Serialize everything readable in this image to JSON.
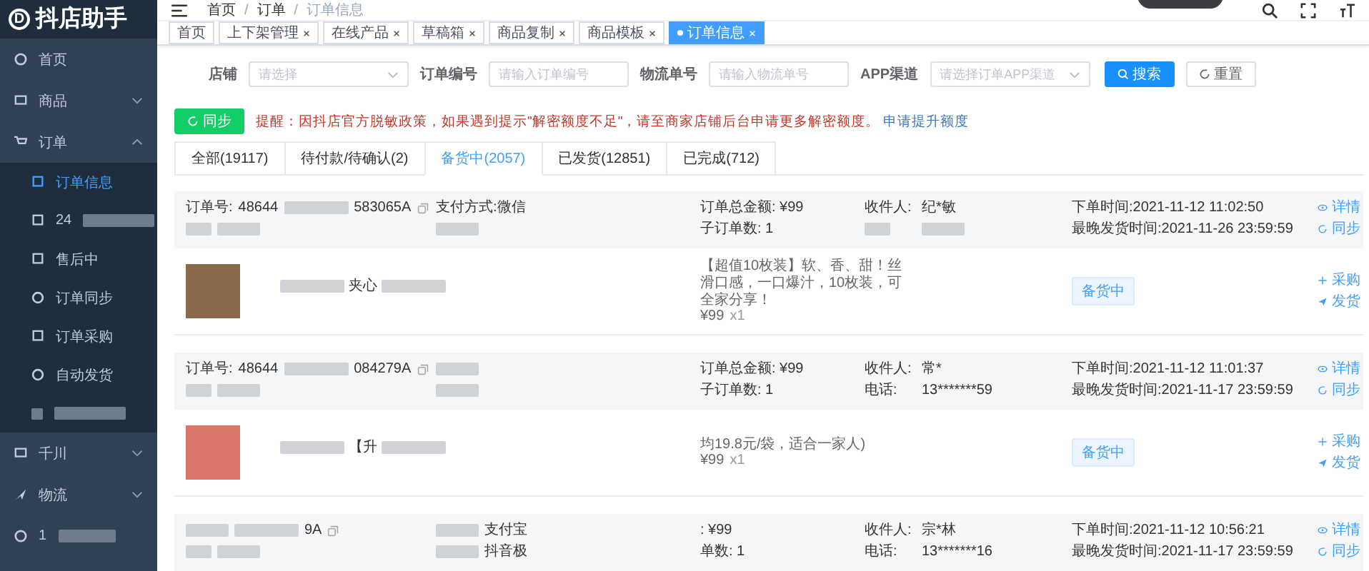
{
  "app": {
    "logo_letter": "D",
    "title": "抖店助手"
  },
  "sidebar": {
    "items": [
      {
        "label": "首页",
        "selected": false,
        "has_children": false,
        "blurred": false
      },
      {
        "label": "商品",
        "expanded": false,
        "selected": false,
        "has_children": true,
        "blurred": false
      },
      {
        "label": "订单",
        "expanded": true,
        "selected": false,
        "has_children": true,
        "blurred": false,
        "children": [
          {
            "label": "订单信息",
            "selected": true,
            "blurred": false
          },
          {
            "label": "24",
            "selected": false,
            "blurred": true
          },
          {
            "label": "售后中",
            "selected": false,
            "blurred": false
          },
          {
            "label": "订单同步",
            "selected": false,
            "blurred": false
          },
          {
            "label": "订单采购",
            "selected": false,
            "blurred": false
          },
          {
            "label": "自动发货",
            "selected": false,
            "blurred": false
          },
          {
            "selected": false,
            "blurred": true
          }
        ]
      },
      {
        "label": "千川",
        "expanded": false,
        "selected": false,
        "has_children": true,
        "blurred": false
      },
      {
        "label": "物流",
        "expanded": false,
        "selected": false,
        "has_children": true,
        "blurred": false
      },
      {
        "label": "1",
        "selected": false,
        "has_children": false,
        "blurred": true
      }
    ]
  },
  "breadcrumb": [
    "首页",
    "订单",
    "订单信息"
  ],
  "breadcrumb_separator": "/",
  "tags": [
    {
      "label": "首页",
      "closable": false,
      "selected": false
    },
    {
      "label": "上下架管理",
      "closable": true,
      "selected": false
    },
    {
      "label": "在线产品",
      "closable": true,
      "selected": false
    },
    {
      "label": "草稿箱",
      "closable": true,
      "selected": false
    },
    {
      "label": "商品复制",
      "closable": true,
      "selected": false
    },
    {
      "label": "商品模板",
      "closable": true,
      "selected": false
    },
    {
      "label": "订单信息",
      "closable": true,
      "selected": true
    }
  ],
  "filters": [
    {
      "label": "店铺",
      "kind": "select",
      "placeholder": "请选择"
    },
    {
      "label": "订单编号",
      "kind": "input",
      "placeholder": "请输入订单编号"
    },
    {
      "label": "物流单号",
      "kind": "input",
      "placeholder": "请输入物流单号"
    },
    {
      "label": "APP渠道",
      "kind": "select",
      "placeholder": "请选择订单APP渠道"
    }
  ],
  "search_button": "搜索",
  "reset_button": "重置",
  "sync_button": "同步",
  "notice": "提醒：因抖店官方脱敏政策，如果遇到提示\"解密额度不足\"，请至商家店铺后台申请更多解密额度。",
  "notice_link": "申请提升额度",
  "tabs": [
    {
      "label": "全部(19117)",
      "selected": false
    },
    {
      "label": "待付款/待确认(2)",
      "selected": false
    },
    {
      "label": "备货中(2057)",
      "selected": true
    },
    {
      "label": "已发货(12851)",
      "selected": false
    },
    {
      "label": "已完成(712)",
      "selected": false
    }
  ],
  "orders": [
    {
      "order_label": "订单号:",
      "order_no_start": "48644",
      "order_no_end": "583065A",
      "pay": [
        "支付方式:微信"
      ],
      "amount": "订单总金额: ¥99",
      "sub_count": "子订单数: 1",
      "recipient_label": "收件人:",
      "recipient": "纪*敏",
      "order_time": "下单时间:2021-11-12 11:02:50",
      "ship_time": "最晚发货时间:2021-11-26 23:59:59",
      "detail": "详情",
      "sync": "同步",
      "item": {
        "title": "夹心",
        "desc": "【超值10枚装】软、香、甜！丝滑口感，一口爆汁，10枚装，可全家分享！",
        "price": "¥99",
        "qty": "x1",
        "status": "备货中",
        "buy": "采购",
        "ship": "发货"
      }
    },
    {
      "order_label": "订单号:",
      "order_no_start": "48644",
      "order_no_end": "084279A",
      "amount": "订单总金额: ¥99",
      "sub_count": "子订单数: 1",
      "recipient_label": "收件人:",
      "recipient": "常*",
      "phone_label": "电话:",
      "phone": "13*******59",
      "order_time": "下单时间:2021-11-12 11:01:37",
      "ship_time": "最晚发货时间:2021-11-17 23:59:59",
      "detail": "详情",
      "sync": "同步",
      "item": {
        "title": "【升",
        "desc": "均19.8元/袋，适合一家人)",
        "price": "¥99",
        "qty": "x1",
        "status": "备货中",
        "buy": "采购",
        "ship": "发货"
      }
    },
    {
      "order_no_end": "9A",
      "pay": [
        "支付宝",
        "抖音极"
      ],
      "amount": ": ¥99",
      "sub_count": "单数: 1",
      "recipient_label": "收件人:",
      "recipient": "宗*林",
      "phone_label": "电话:",
      "phone": "13*******16",
      "order_time": "下单时间:2021-11-12 10:56:21",
      "ship_time": "最晚发货时间:2021-11-17 23:59:59",
      "detail": "详情",
      "sync": "同步"
    }
  ]
}
